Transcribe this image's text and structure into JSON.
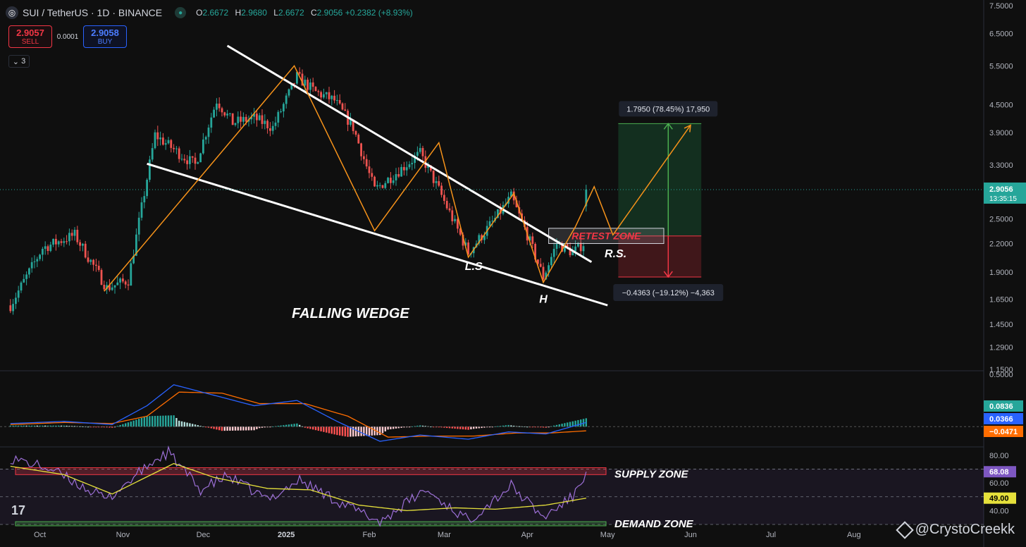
{
  "header": {
    "symbol": "SUI / TetherUS · 1D · BINANCE",
    "open_label": "O",
    "open": "2.6672",
    "high_label": "H",
    "high": "2.9680",
    "low_label": "L",
    "low": "2.6672",
    "close_label": "C",
    "close": "2.9056",
    "change": "+0.2382 (+8.93%)"
  },
  "trade": {
    "sell_price": "2.9057",
    "sell_label": "SELL",
    "spread": "0.0001",
    "buy_price": "2.9058",
    "buy_label": "BUY",
    "indicator_count": "3"
  },
  "watermark": "@CrystoCreekk",
  "tv_logo": "17",
  "colors": {
    "up": "#26a69a",
    "down": "#ef5350",
    "wedge": "#ffffff",
    "zigzag": "#f7931a",
    "macd": "#2962ff",
    "signal": "#ff6d00",
    "rsi": "#9c6fd6",
    "rsi_ma": "#e6e13b"
  },
  "chart_data": [
    {
      "type": "candlestick",
      "scale": "log",
      "ylim": [
        1.15,
        7.5
      ],
      "x_ticks": [
        "Oct",
        "Nov",
        "Dec",
        "2025",
        "Feb",
        "Mar",
        "Apr",
        "May",
        "Jun",
        "Jul",
        "Aug"
      ],
      "y_ticks": [
        "7.5000",
        "6.5000",
        "5.5000",
        "4.5000",
        "3.9000",
        "3.3000",
        "2.5000",
        "2.2000",
        "1.9000",
        "1.6500",
        "1.4500",
        "1.2900",
        "1.1500"
      ],
      "last_price": "2.9056",
      "countdown": "13:35:15",
      "keypoints": [
        {
          "date": "2024-09-20",
          "price": 1.6
        },
        {
          "date": "2024-10-02",
          "price": 2.15
        },
        {
          "date": "2024-10-14",
          "price": 2.3
        },
        {
          "date": "2024-10-26",
          "price": 1.75
        },
        {
          "date": "2024-11-03",
          "price": 1.82
        },
        {
          "date": "2024-11-13",
          "price": 3.85
        },
        {
          "date": "2024-11-22",
          "price": 3.5
        },
        {
          "date": "2024-11-28",
          "price": 3.3
        },
        {
          "date": "2024-12-06",
          "price": 4.6
        },
        {
          "date": "2024-12-12",
          "price": 4.1
        },
        {
          "date": "2024-12-20",
          "price": 4.2
        },
        {
          "date": "2024-12-27",
          "price": 4.0
        },
        {
          "date": "2025-01-05",
          "price": 5.2
        },
        {
          "date": "2025-01-12",
          "price": 4.8
        },
        {
          "date": "2025-01-19",
          "price": 4.6
        },
        {
          "date": "2025-01-26",
          "price": 4.0
        },
        {
          "date": "2025-02-03",
          "price": 2.9
        },
        {
          "date": "2025-02-12",
          "price": 3.2
        },
        {
          "date": "2025-02-20",
          "price": 3.5
        },
        {
          "date": "2025-02-27",
          "price": 2.9
        },
        {
          "date": "2025-03-10",
          "price": 2.1
        },
        {
          "date": "2025-03-20",
          "price": 2.5
        },
        {
          "date": "2025-03-26",
          "price": 2.8
        },
        {
          "date": "2025-04-01",
          "price": 2.3
        },
        {
          "date": "2025-04-07",
          "price": 1.85
        },
        {
          "date": "2025-04-12",
          "price": 2.2
        },
        {
          "date": "2025-04-18",
          "price": 2.1
        },
        {
          "date": "2025-04-22",
          "price": 2.2
        },
        {
          "date": "2025-04-23",
          "price": 2.9056
        }
      ],
      "wedge": {
        "upper": [
          {
            "date": "2024-12-10",
            "price": 6.1
          },
          {
            "date": "2025-04-25",
            "price": 2.0
          }
        ],
        "lower": [
          {
            "date": "2024-11-10",
            "price": 3.32
          },
          {
            "date": "2025-05-01",
            "price": 1.6
          }
        ]
      },
      "zigzag": [
        {
          "date": "2024-10-25",
          "price": 1.72
        },
        {
          "date": "2025-01-04",
          "price": 5.5
        },
        {
          "date": "2025-02-03",
          "price": 2.35
        },
        {
          "date": "2025-02-27",
          "price": 3.7
        },
        {
          "date": "2025-03-10",
          "price": 2.05
        },
        {
          "date": "2025-03-27",
          "price": 2.85
        },
        {
          "date": "2025-04-07",
          "price": 1.8
        },
        {
          "date": "2025-04-19",
          "price": 2.4
        },
        {
          "date": "2025-04-26",
          "price": 2.95
        },
        {
          "date": "2025-05-03",
          "price": 2.3
        },
        {
          "date": "2025-06-01",
          "price": 4.05
        }
      ],
      "labels": [
        {
          "text": "FALLING WEDGE",
          "date": "2025-01-25",
          "price": 1.5
        },
        {
          "text": "L.S",
          "date": "2025-03-12",
          "price": 1.92
        },
        {
          "text": "H",
          "date": "2025-04-07",
          "price": 1.62
        },
        {
          "text": "R.S.",
          "date": "2025-05-04",
          "price": 2.05
        }
      ],
      "retest_zone": {
        "label": "RETEST ZONE",
        "date_start": "2025-04-09",
        "date_end": "2025-05-22",
        "price_high": 2.38,
        "price_low": 2.2
      },
      "position": {
        "date_start": "2025-05-05",
        "date_end": "2025-06-05",
        "entry": 2.2875,
        "target": 4.0825,
        "stop": 1.8512,
        "target_label": "1.7950 (78.45%) 17,950",
        "stop_label": "−0.4363 (−19.12%) −4,363"
      }
    },
    {
      "type": "line",
      "name": "MACD",
      "ylim": [
        -0.18,
        0.52
      ],
      "y_ticks": [
        "0.5000"
      ],
      "histogram": "0.0836",
      "macd": "0.0366",
      "signal": "-0.0471",
      "macd_keypoints": [
        {
          "date": "2024-09-20",
          "macd": 0.03
        },
        {
          "date": "2024-10-10",
          "macd": 0.05
        },
        {
          "date": "2024-10-28",
          "macd": 0.02
        },
        {
          "date": "2024-11-10",
          "macd": 0.2
        },
        {
          "date": "2024-11-20",
          "macd": 0.4
        },
        {
          "date": "2024-12-05",
          "macd": 0.3
        },
        {
          "date": "2024-12-20",
          "macd": 0.2
        },
        {
          "date": "2025-01-05",
          "macd": 0.25
        },
        {
          "date": "2025-01-20",
          "macd": 0.05
        },
        {
          "date": "2025-02-05",
          "macd": -0.14
        },
        {
          "date": "2025-02-20",
          "macd": -0.08
        },
        {
          "date": "2025-03-10",
          "macd": -0.12
        },
        {
          "date": "2025-03-25",
          "macd": -0.05
        },
        {
          "date": "2025-04-08",
          "macd": -0.07
        },
        {
          "date": "2025-04-23",
          "macd": 0.04
        }
      ],
      "signal_keypoints": [
        {
          "date": "2024-09-20",
          "signal": 0.02
        },
        {
          "date": "2024-10-10",
          "signal": 0.04
        },
        {
          "date": "2024-10-28",
          "signal": 0.03
        },
        {
          "date": "2024-11-10",
          "signal": 0.1
        },
        {
          "date": "2024-11-22",
          "signal": 0.33
        },
        {
          "date": "2024-12-08",
          "signal": 0.32
        },
        {
          "date": "2024-12-22",
          "signal": 0.22
        },
        {
          "date": "2025-01-08",
          "signal": 0.22
        },
        {
          "date": "2025-01-24",
          "signal": 0.1
        },
        {
          "date": "2025-02-08",
          "signal": -0.1
        },
        {
          "date": "2025-02-24",
          "signal": -0.09
        },
        {
          "date": "2025-03-12",
          "signal": -0.09
        },
        {
          "date": "2025-03-28",
          "signal": -0.06
        },
        {
          "date": "2025-04-10",
          "signal": -0.06
        },
        {
          "date": "2025-04-23",
          "signal": -0.04
        }
      ]
    },
    {
      "type": "line",
      "name": "RSI",
      "ylim": [
        30,
        85
      ],
      "y_ticks": [
        "80.00",
        "60.00",
        "40.00"
      ],
      "rsi": "68.08",
      "rsi_ma": "49.00",
      "supply_zone": {
        "label": "SUPPLY ZONE",
        "high": 71,
        "low": 66
      },
      "demand_zone": {
        "label": "DEMAND ZONE",
        "high": 32,
        "low": 29
      },
      "rsi_keypoints": [
        {
          "date": "2024-09-20",
          "rsi": 78
        },
        {
          "date": "2024-10-05",
          "rsi": 70
        },
        {
          "date": "2024-10-26",
          "rsi": 48
        },
        {
          "date": "2024-11-12",
          "rsi": 75
        },
        {
          "date": "2024-11-18",
          "rsi": 82
        },
        {
          "date": "2024-11-30",
          "rsi": 55
        },
        {
          "date": "2024-12-10",
          "rsi": 65
        },
        {
          "date": "2024-12-25",
          "rsi": 48
        },
        {
          "date": "2025-01-06",
          "rsi": 62
        },
        {
          "date": "2025-01-22",
          "rsi": 45
        },
        {
          "date": "2025-02-05",
          "rsi": 32
        },
        {
          "date": "2025-02-22",
          "rsi": 55
        },
        {
          "date": "2025-03-10",
          "rsi": 33
        },
        {
          "date": "2025-03-26",
          "rsi": 58
        },
        {
          "date": "2025-04-07",
          "rsi": 35
        },
        {
          "date": "2025-04-18",
          "rsi": 50
        },
        {
          "date": "2025-04-23",
          "rsi": 68
        }
      ],
      "ma_keypoints": [
        {
          "date": "2024-09-20",
          "ma": 72
        },
        {
          "date": "2024-10-10",
          "ma": 66
        },
        {
          "date": "2024-10-28",
          "ma": 52
        },
        {
          "date": "2024-11-20",
          "ma": 74
        },
        {
          "date": "2024-12-05",
          "ma": 64
        },
        {
          "date": "2024-12-25",
          "ma": 56
        },
        {
          "date": "2025-01-10",
          "ma": 55
        },
        {
          "date": "2025-01-28",
          "ma": 44
        },
        {
          "date": "2025-02-15",
          "ma": 40
        },
        {
          "date": "2025-03-05",
          "ma": 42
        },
        {
          "date": "2025-03-20",
          "ma": 41
        },
        {
          "date": "2025-04-08",
          "ma": 44
        },
        {
          "date": "2025-04-23",
          "ma": 49
        }
      ]
    }
  ]
}
